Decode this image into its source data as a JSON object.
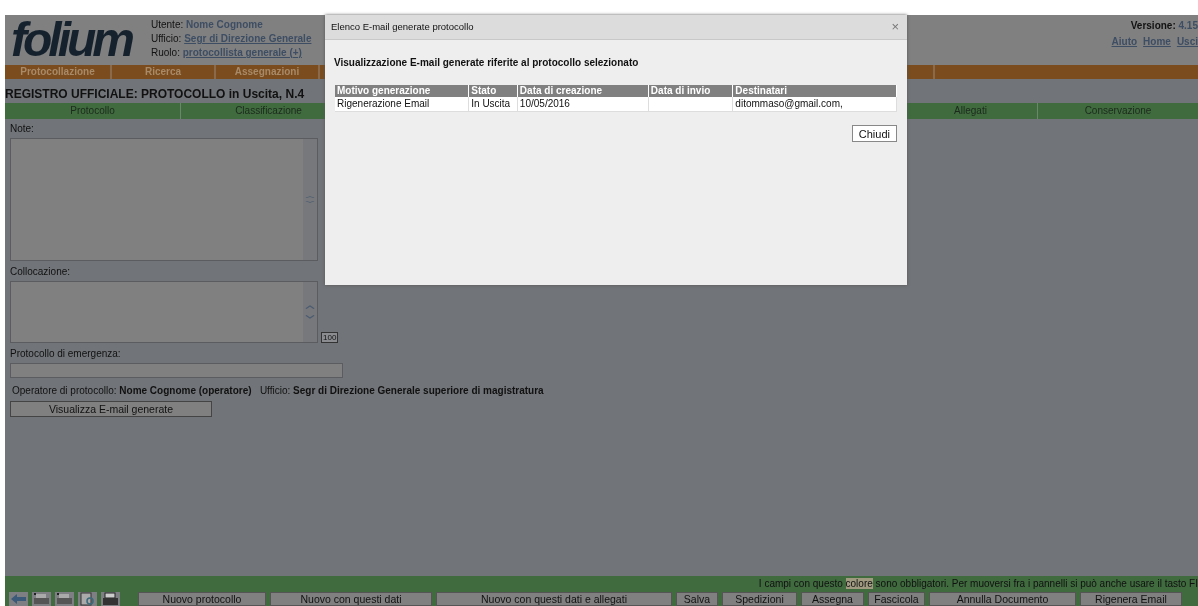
{
  "header": {
    "logo": "folium",
    "user_label": "Utente:",
    "user": "Nome Cognome",
    "office_label": "Ufficio:",
    "office": "Segr di Direzione Generale",
    "role_label": "Ruolo:",
    "role": "protocollista generale (+)",
    "version_label": "Versione:",
    "version": "4.15",
    "links": [
      "Aiuto",
      "Home",
      "Usci"
    ]
  },
  "nav": [
    "Protocollazione",
    "Ricerca",
    "Assegnazioni"
  ],
  "document_title": "REGISTRO UFFICIALE: PROTOCOLLO in Uscita, N.4",
  "tabs": {
    "left": [
      {
        "label": "Protocollo",
        "selected": false
      },
      {
        "label": "Classificazione",
        "selected": false
      }
    ],
    "right": [
      {
        "label": "Allegati",
        "selected": false
      },
      {
        "label": "Conservazione",
        "selected": false
      }
    ]
  },
  "form": {
    "note_label": "Note:",
    "location_label": "Collocazione:",
    "location_counter": "100",
    "emergency_label": "Protocollo di emergenza:",
    "operator_label": "Operatore di protocollo:",
    "operator": "Nome Cognome (operatore)",
    "office_label": "Ufficio:",
    "office": "Segr di Direzione Generale superiore di magistratura",
    "show_emails_button": "Visualizza E-mail generate"
  },
  "dialog": {
    "title": "Elenco E-mail generate protocollo",
    "close": "×",
    "heading": "Visualizzazione E-mail generate riferite al protocollo selezionato",
    "columns": [
      "Motivo generazione",
      "Stato",
      "Data di creazione",
      "Data di invio",
      "Destinatari"
    ],
    "rows": [
      [
        "Rigenerazione Email",
        "In Uscita",
        "10/05/2016",
        "",
        "ditommaso@gmail.com,"
      ]
    ],
    "button": "Chiudi"
  },
  "footer": {
    "notice_before": "I campi con questo",
    "notice_highlight": "colore",
    "notice_after": "sono obbligatori. Per muoversi fra i pannelli si può anche usare il tasto FI",
    "buttons": [
      "Nuovo protocollo",
      "Nuovo con questi dati",
      "Nuovo con questi dati e allegati",
      "Salva",
      "Spedizioni",
      "Assegna",
      "Fascicola",
      "Annulla Documento",
      "Rigenera Email"
    ]
  }
}
